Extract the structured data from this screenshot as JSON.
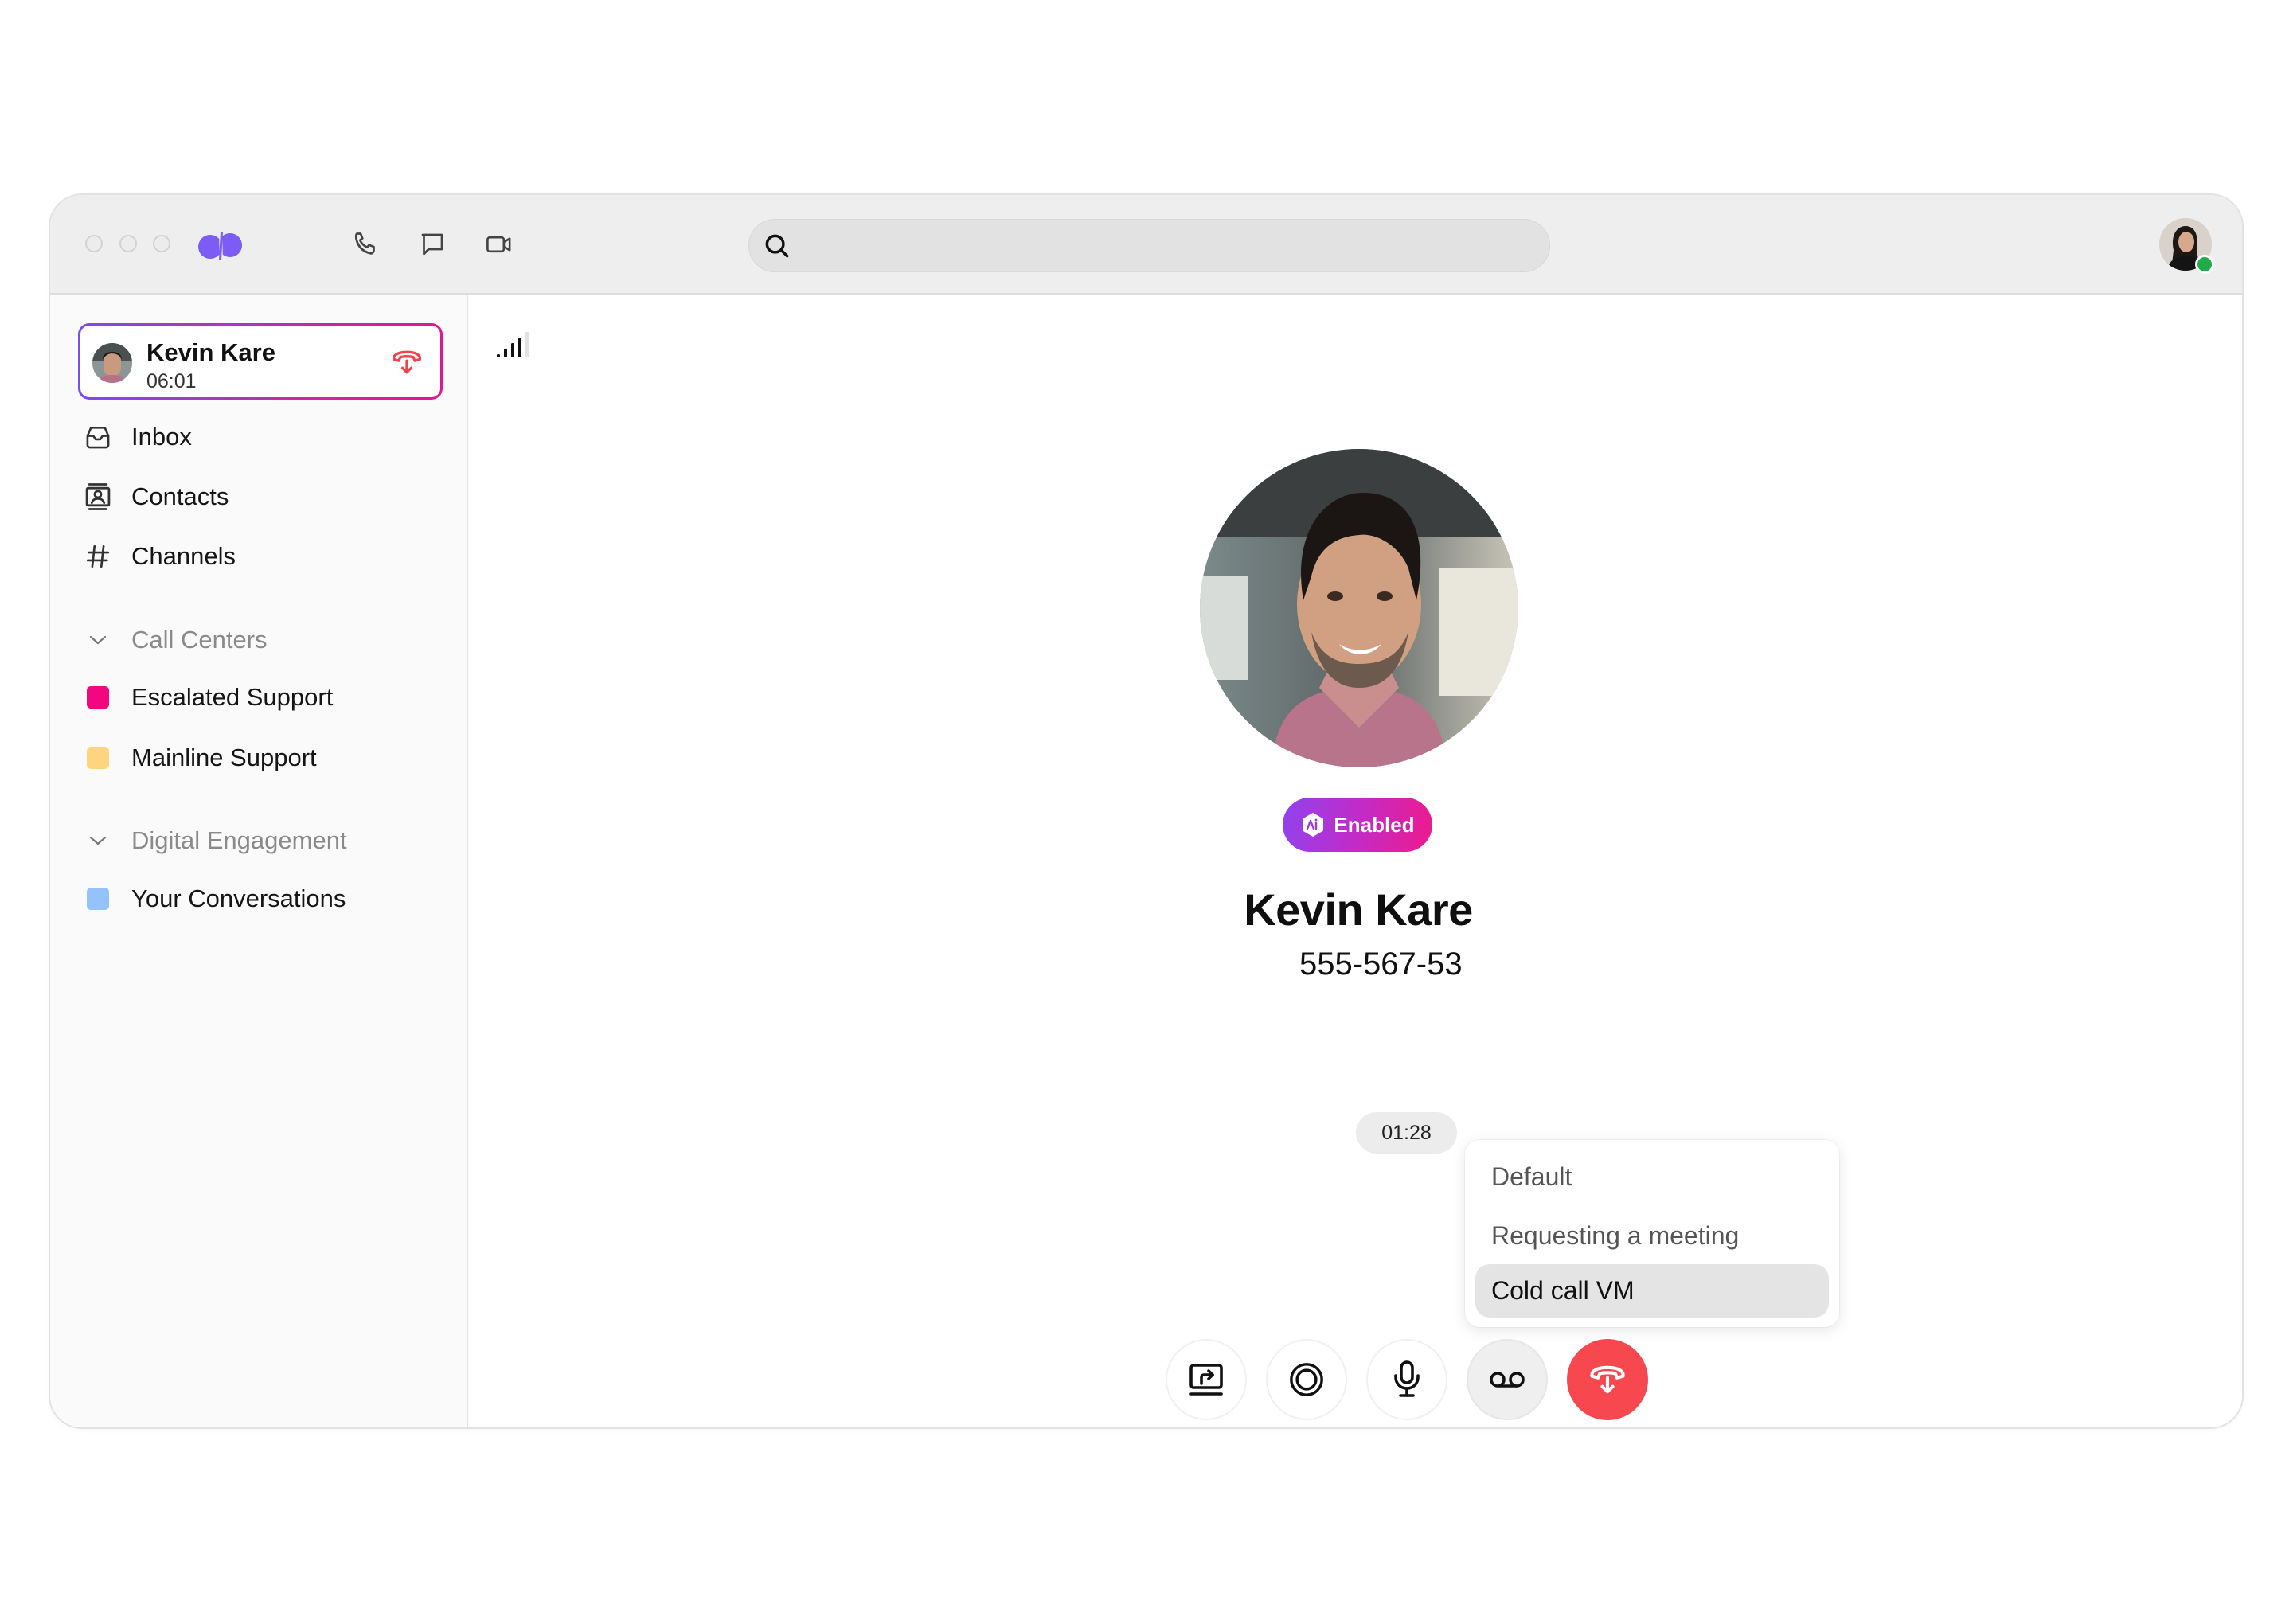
{
  "titlebar": {
    "nav_icons": [
      "phone-icon",
      "chat-icon",
      "video-icon"
    ],
    "search": {
      "placeholder": "",
      "value": ""
    },
    "user_status": "online"
  },
  "sidebar": {
    "active_call": {
      "name": "Kevin Kare",
      "duration": "06:01"
    },
    "nav": [
      {
        "label": "Inbox",
        "icon": "inbox-icon"
      },
      {
        "label": "Contacts",
        "icon": "contacts-icon"
      },
      {
        "label": "Channels",
        "icon": "hash-icon"
      }
    ],
    "sections": [
      {
        "title": "Call Centers",
        "items": [
          {
            "label": "Escalated Support",
            "color": "#F2077F"
          },
          {
            "label": "Mainline Support",
            "color": "#FDD57E"
          }
        ]
      },
      {
        "title": "Digital Engagement",
        "items": [
          {
            "label": "Your Conversations",
            "color": "#94C3FB"
          }
        ]
      }
    ]
  },
  "call": {
    "signal_bars": 4,
    "signal_bars_total": 5,
    "ai_badge": "Enabled",
    "contact_name": "Kevin Kare",
    "phone": "555-567-53",
    "timer": "01:28",
    "voicemail_menu": {
      "options": [
        "Default",
        "Requesting a meeting",
        "Cold call VM"
      ],
      "selected": "Cold call VM"
    },
    "controls": [
      "transfer",
      "record",
      "mute",
      "voicemail-drop",
      "hang-up"
    ]
  },
  "colors": {
    "brand": "#7C5CF5",
    "hangup": "#F7474F",
    "presence": "#1FAB4A"
  }
}
